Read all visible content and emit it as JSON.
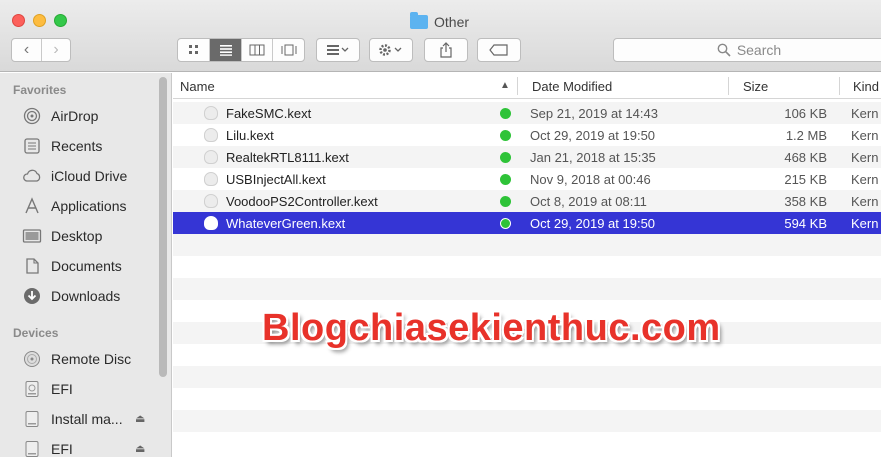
{
  "window": {
    "title": "Other"
  },
  "toolbar": {
    "back_glyph": "‹",
    "forward_glyph": "›",
    "search_placeholder": "Search"
  },
  "sidebar": {
    "favorites_heading": "Favorites",
    "favorites": [
      {
        "label": "AirDrop",
        "icon": "airdrop-icon"
      },
      {
        "label": "Recents",
        "icon": "recents-icon"
      },
      {
        "label": "iCloud Drive",
        "icon": "icloud-icon"
      },
      {
        "label": "Applications",
        "icon": "applications-icon"
      },
      {
        "label": "Desktop",
        "icon": "desktop-icon"
      },
      {
        "label": "Documents",
        "icon": "documents-icon"
      },
      {
        "label": "Downloads",
        "icon": "downloads-icon"
      }
    ],
    "devices_heading": "Devices",
    "devices": [
      {
        "label": "Remote Disc",
        "icon": "disc-icon"
      },
      {
        "label": "EFI",
        "icon": "drive-icon"
      },
      {
        "label": "Install ma...",
        "icon": "drive-icon"
      },
      {
        "label": "EFI",
        "icon": "drive-icon"
      }
    ]
  },
  "columns": {
    "name": "Name",
    "date": "Date Modified",
    "size": "Size",
    "kind": "Kind"
  },
  "files": [
    {
      "name": "FakeSMC.kext",
      "date": "Sep 21, 2019 at 14:43",
      "size": "106 KB",
      "kind": "Kern"
    },
    {
      "name": "Lilu.kext",
      "date": "Oct 29, 2019 at 19:50",
      "size": "1.2 MB",
      "kind": "Kern"
    },
    {
      "name": "RealtekRTL8111.kext",
      "date": "Jan 21, 2018 at 15:35",
      "size": "468 KB",
      "kind": "Kern"
    },
    {
      "name": "USBInjectAll.kext",
      "date": "Nov 9, 2018 at 00:46",
      "size": "215 KB",
      "kind": "Kern"
    },
    {
      "name": "VoodooPS2Controller.kext",
      "date": "Oct 8, 2019 at 08:11",
      "size": "358 KB",
      "kind": "Kern"
    },
    {
      "name": "WhateverGreen.kext",
      "date": "Oct 29, 2019 at 19:50",
      "size": "594 KB",
      "kind": "Kern"
    }
  ],
  "selected_file_index": 5,
  "colors": {
    "selection": "#3535d5",
    "tag_green": "#2ec338",
    "watermark": "#e8322a"
  },
  "watermark": "Blogchiasekienthuc.com"
}
